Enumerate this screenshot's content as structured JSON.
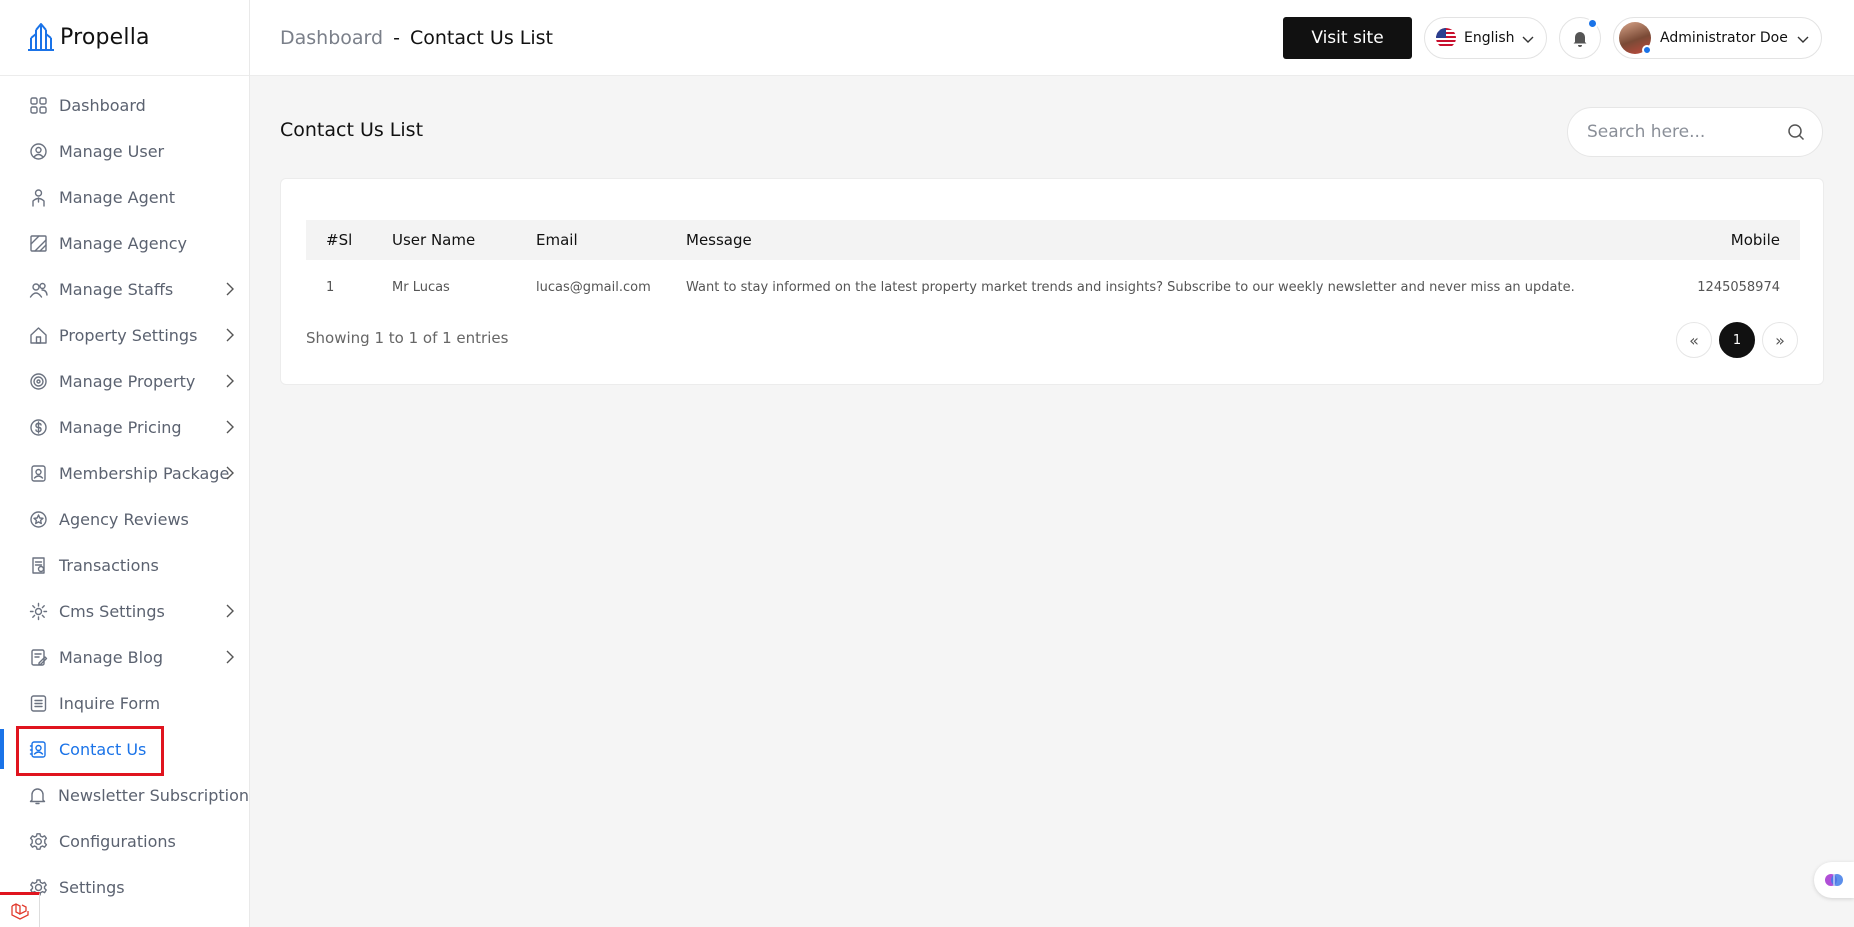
{
  "brand": {
    "name": "Propella",
    "accent": "#1a73e8"
  },
  "sidebar": {
    "items": [
      {
        "label": "Dashboard",
        "icon": "grid-icon",
        "has_children": false
      },
      {
        "label": "Manage User",
        "icon": "user-circle-icon",
        "has_children": false
      },
      {
        "label": "Manage Agent",
        "icon": "agent-icon",
        "has_children": false
      },
      {
        "label": "Manage Agency",
        "icon": "agency-icon",
        "has_children": false
      },
      {
        "label": "Manage Staffs",
        "icon": "users-icon",
        "has_children": true
      },
      {
        "label": "Property Settings",
        "icon": "home-icon",
        "has_children": true
      },
      {
        "label": "Manage Property",
        "icon": "target-icon",
        "has_children": true
      },
      {
        "label": "Manage Pricing",
        "icon": "dollar-icon",
        "has_children": true
      },
      {
        "label": "Membership Package",
        "icon": "id-card-icon",
        "has_children": true
      },
      {
        "label": "Agency Reviews",
        "icon": "star-badge-icon",
        "has_children": false
      },
      {
        "label": "Transactions",
        "icon": "receipt-icon",
        "has_children": false
      },
      {
        "label": "Cms Settings",
        "icon": "gear-icon",
        "has_children": true
      },
      {
        "label": "Manage Blog",
        "icon": "edit-doc-icon",
        "has_children": true
      },
      {
        "label": "Inquire Form",
        "icon": "list-icon",
        "has_children": false
      },
      {
        "label": "Contact Us",
        "icon": "contact-icon",
        "has_children": false,
        "active": true
      },
      {
        "label": "Newsletter Subscription",
        "icon": "bell-outline-icon",
        "has_children": false
      },
      {
        "label": "Configurations",
        "icon": "cog-icon",
        "has_children": false
      },
      {
        "label": "Settings",
        "icon": "settings-icon",
        "has_children": false
      }
    ]
  },
  "header": {
    "breadcrumb_root": "Dashboard",
    "breadcrumb_sep": "-",
    "breadcrumb_current": "Contact Us List",
    "visit_site_label": "Visit site",
    "language": "English",
    "user_name": "Administrator Doe"
  },
  "main": {
    "title": "Contact Us List",
    "search_placeholder": "Search here...",
    "table": {
      "headers": [
        "#Sl",
        "User Name",
        "Email",
        "Message",
        "Mobile"
      ],
      "rows": [
        [
          "1",
          "Mr Lucas",
          "lucas@gmail.com",
          "Want to stay informed on the latest property market trends and insights? Subscribe to our weekly newsletter and never miss an update.",
          "1245058974"
        ]
      ]
    },
    "entries_info": "Showing 1 to 1 of 1 entries",
    "pagination": {
      "prev": "«",
      "current": "1",
      "next": "»"
    }
  }
}
